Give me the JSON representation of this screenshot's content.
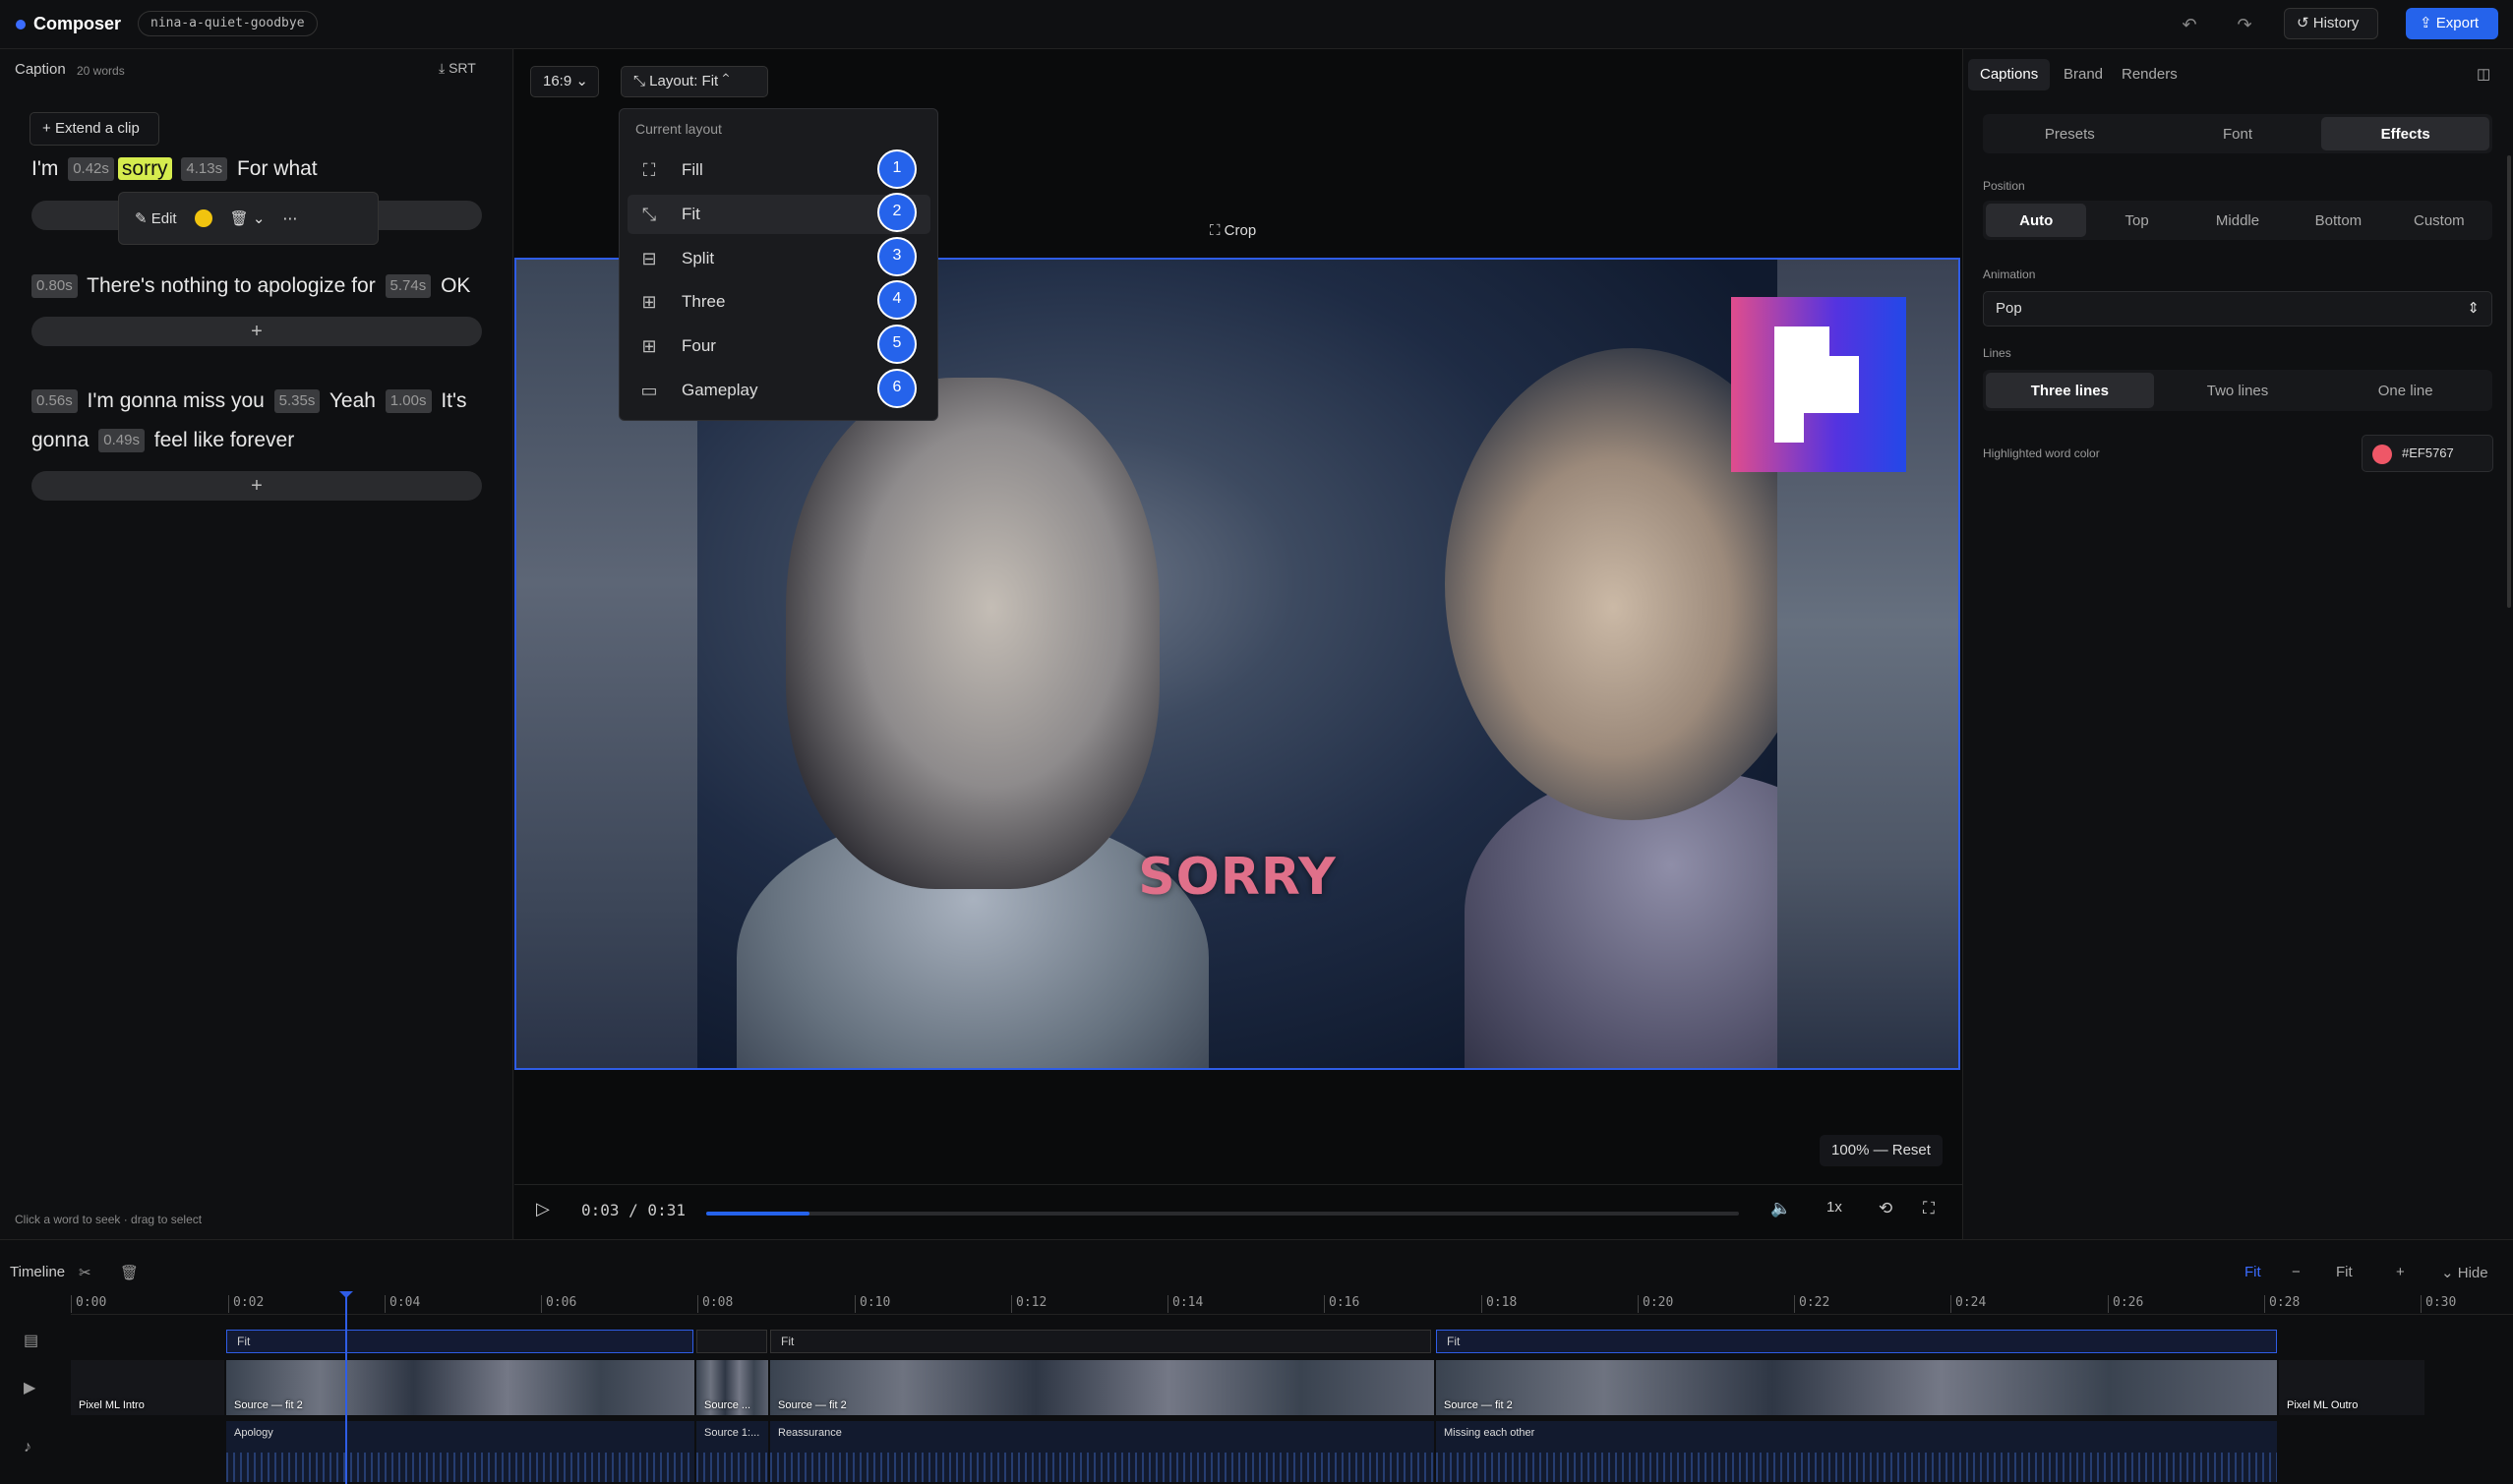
{
  "topbar": {
    "app_name": "Composer",
    "project": "nina-a-quiet-goodbye",
    "history": "History",
    "export": "Export"
  },
  "caption": {
    "title": "Caption",
    "word_count": "20 words",
    "srt": "SRT",
    "extend": "Extend a clip",
    "edit": "Edit",
    "footer": "Click a word to seek · drag to select",
    "line1": {
      "w1": "I'm",
      "t1": "0.42s",
      "w2": "sorry",
      "t2": "4.13s",
      "w3": "For what"
    },
    "line2": {
      "t1": "0.80s",
      "w1": "There's nothing to apologize for",
      "t2": "5.74s",
      "w2": "OK"
    },
    "line3": {
      "t1": "0.56s",
      "w1": "I'm gonna miss you",
      "t2": "5.35s",
      "w2": "Yeah",
      "t3": "1.00s",
      "w3": "It's",
      "w4": "gonna",
      "t4": "0.49s",
      "w5": "feel like forever"
    },
    "add": "+"
  },
  "center": {
    "ratio": "16:9",
    "layout_btn": "Layout: Fit",
    "crop": "Crop",
    "caption_word": "SORRY",
    "zoom_reset": "100% — Reset",
    "time": "0:03 / 0:31",
    "progress": 0.1,
    "speed": "1x"
  },
  "layout_menu": {
    "header": "Current layout",
    "items": [
      {
        "label": "Fill",
        "badge": "1"
      },
      {
        "label": "Fit",
        "badge": "2"
      },
      {
        "label": "Split",
        "badge": "3"
      },
      {
        "label": "Three",
        "badge": "4"
      },
      {
        "label": "Four",
        "badge": "5"
      },
      {
        "label": "Gameplay",
        "badge": "6"
      }
    ]
  },
  "right": {
    "tabs": [
      "Captions",
      "Brand",
      "Renders"
    ],
    "subtabs": [
      "Presets",
      "Font",
      "Effects"
    ],
    "position_label": "Position",
    "positions": [
      "Auto",
      "Top",
      "Middle",
      "Bottom",
      "Custom"
    ],
    "animation_label": "Animation",
    "animation": "Pop",
    "lines_label": "Lines",
    "lines": [
      "Three lines",
      "Two lines",
      "One line"
    ],
    "highlight_label": "Highlighted word color",
    "highlight_color": "#EF5767"
  },
  "timeline": {
    "title": "Timeline",
    "fit_blue": "Fit",
    "fit": "Fit",
    "hide": "Hide",
    "ticks": [
      "0:00",
      "0:02",
      "0:04",
      "0:06",
      "0:08",
      "0:10",
      "0:12",
      "0:14",
      "0:16",
      "0:18",
      "0:20",
      "0:22",
      "0:24",
      "0:26",
      "0:28",
      "0:30"
    ],
    "layout_segments": [
      "Fit",
      "",
      "Fit",
      "Fit"
    ],
    "clips": [
      "Pixel ML Intro",
      "Source — fit 2",
      "Source ...",
      "Source — fit 2",
      "Source — fit 2",
      "Pixel ML Outro"
    ],
    "audio": [
      "Apology",
      "Source 1:...",
      "Reassurance",
      "Missing each other"
    ]
  }
}
